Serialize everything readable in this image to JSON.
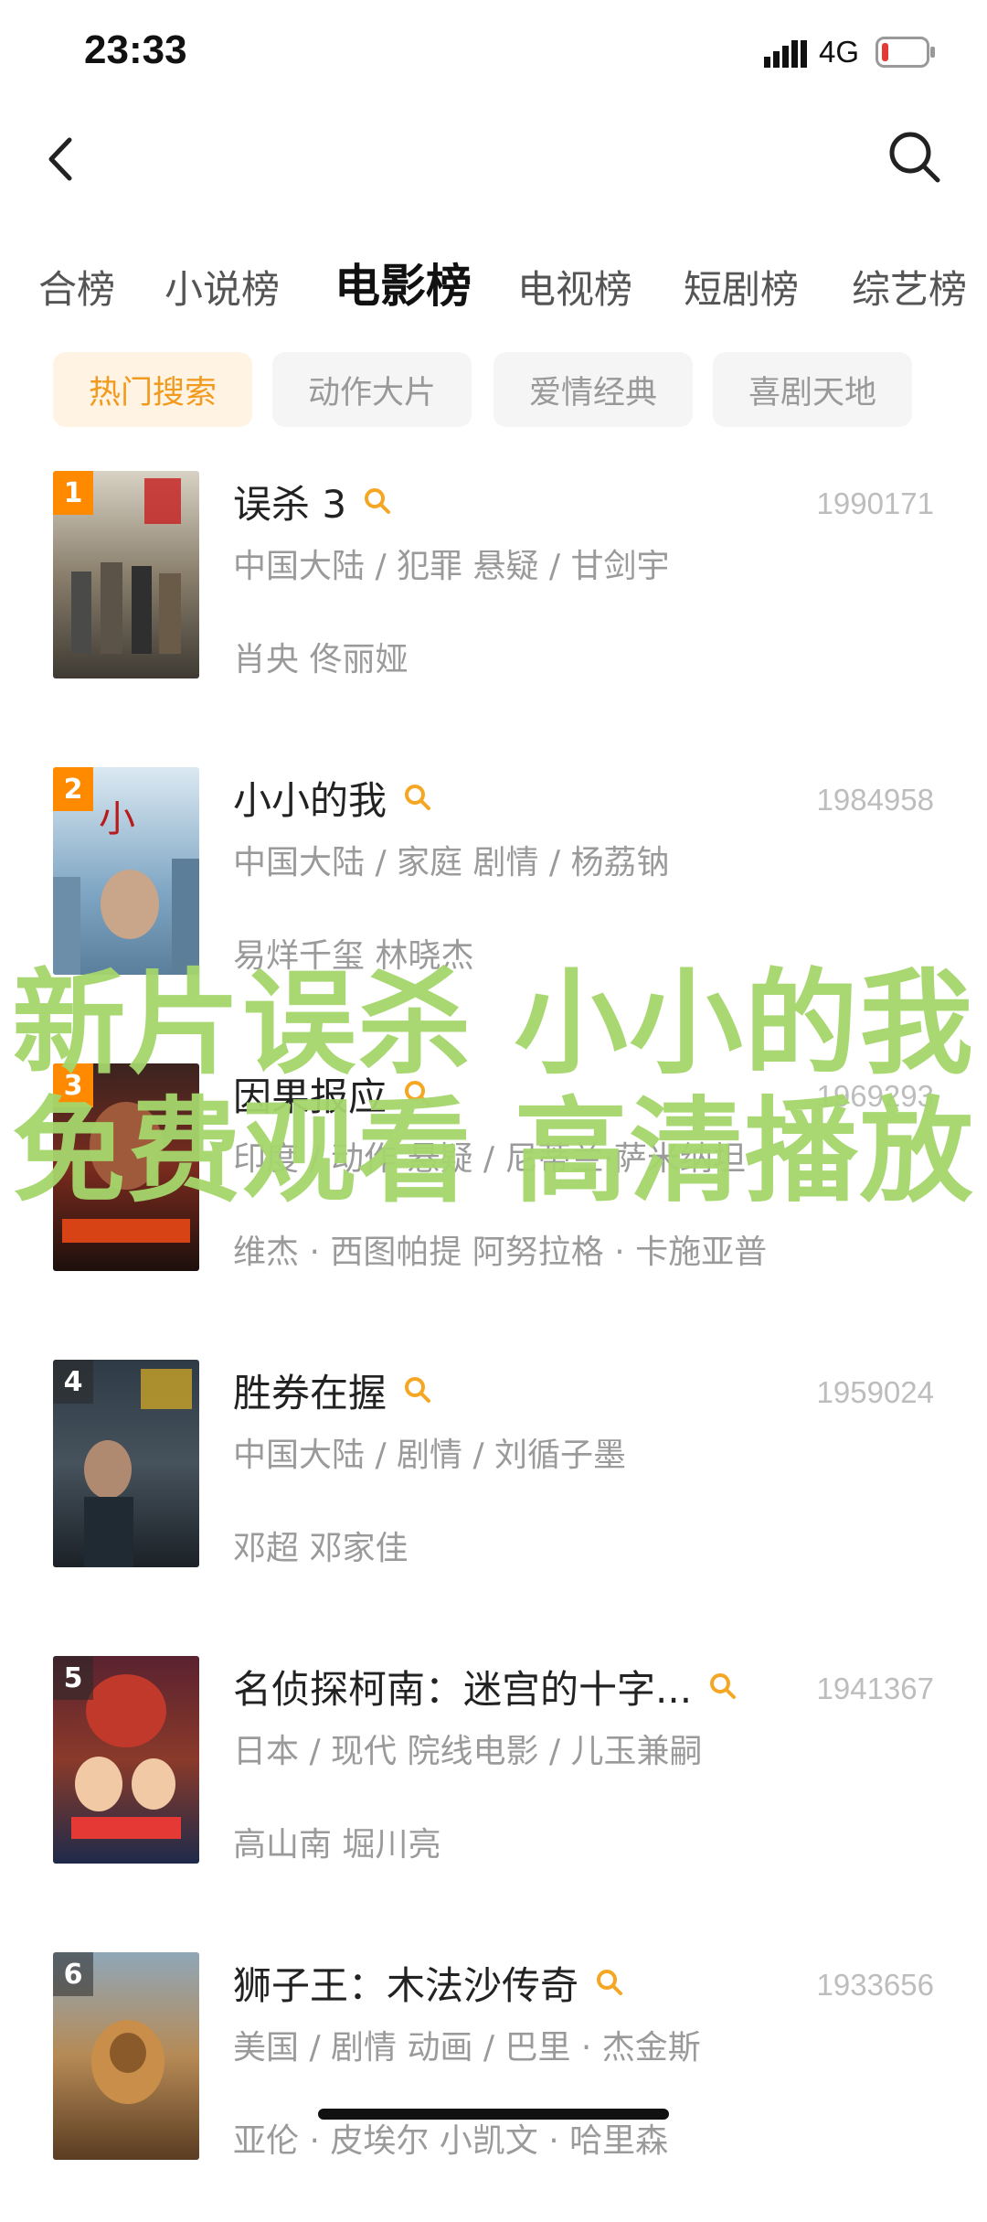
{
  "status_bar": {
    "time": "23:33",
    "network": "4G"
  },
  "tabs": [
    "合榜",
    "小说榜",
    "电影榜",
    "电视榜",
    "短剧榜",
    "综艺榜"
  ],
  "filters": [
    "热门搜索",
    "动作大片",
    "爱情经典",
    "喜剧天地"
  ],
  "movies": [
    {
      "rank": "1",
      "title": "误杀 3",
      "count": "1990171",
      "meta": "中国大陆 / 犯罪 悬疑 / 甘剑宇",
      "cast": "肖央 佟丽娅"
    },
    {
      "rank": "2",
      "title": "小小的我",
      "count": "1984958",
      "meta": "中国大陆 / 家庭 剧情 / 杨荔钠",
      "cast": "易烊千玺 林晓杰"
    },
    {
      "rank": "3",
      "title": "因果报应",
      "count": "1969293",
      "meta": "印度 / 动作 悬疑 / 尼蒂兰·萨米纳坦",
      "cast": "维杰 · 西图帕提 阿努拉格 · 卡施亚普"
    },
    {
      "rank": "4",
      "title": "胜券在握",
      "count": "1959024",
      "meta": "中国大陆 / 剧情 / 刘循子墨",
      "cast": "邓超 邓家佳"
    },
    {
      "rank": "5",
      "title": "名侦探柯南：迷宫的十字...",
      "count": "1941367",
      "meta": "日本 / 现代 院线电影 / 儿玉兼嗣",
      "cast": "高山南 堀川亮"
    },
    {
      "rank": "6",
      "title": "狮子王：木法沙传奇",
      "count": "1933656",
      "meta": "美国 / 剧情 动画 / 巴里 · 杰金斯",
      "cast": "亚伦 · 皮埃尔 小凯文 · 哈里森"
    }
  ],
  "overlay": {
    "line1": "新片误杀 小小的我",
    "line2": "免费观看 高清播放"
  },
  "colors": {
    "accent": "#ff8a00",
    "overlay": "#a5d66c",
    "chip_active_bg": "#fff3e3"
  }
}
